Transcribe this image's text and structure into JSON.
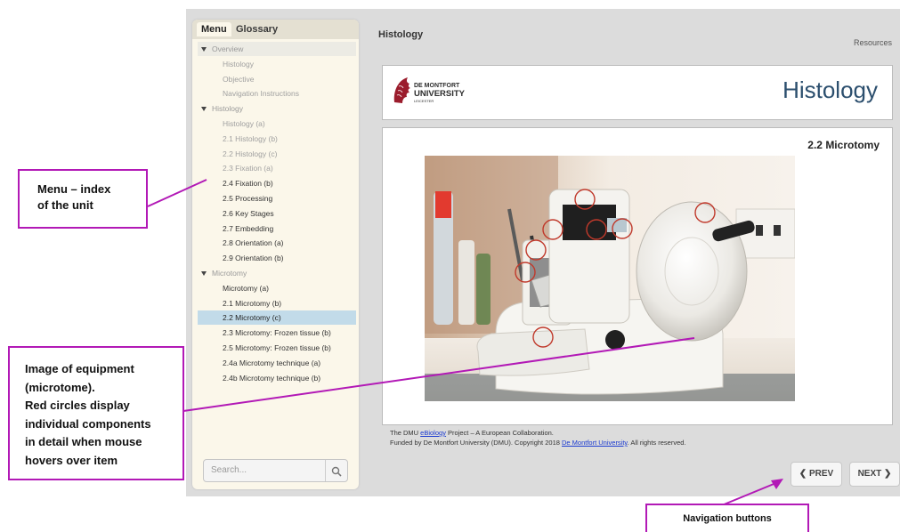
{
  "sidebar": {
    "tabs": [
      "Menu",
      "Glossary"
    ],
    "menu": [
      {
        "label": "Overview",
        "type": "section"
      },
      {
        "label": "Histology",
        "type": "dim"
      },
      {
        "label": "Objective",
        "type": "dim"
      },
      {
        "label": "Navigation Instructions",
        "type": "dim"
      },
      {
        "label": "Histology",
        "type": "section"
      },
      {
        "label": "Histology (a)",
        "type": "dim"
      },
      {
        "label": "2.1 Histology (b)",
        "type": "dim"
      },
      {
        "label": "2.2 Histology (c)",
        "type": "dim"
      },
      {
        "label": "2.3 Fixation (a)",
        "type": "dim"
      },
      {
        "label": "2.4 Fixation (b)",
        "type": "item"
      },
      {
        "label": "2.5 Processing",
        "type": "item"
      },
      {
        "label": "2.6 Key Stages",
        "type": "item"
      },
      {
        "label": "2.7 Embedding",
        "type": "item"
      },
      {
        "label": "2.8 Orientation (a)",
        "type": "item"
      },
      {
        "label": "2.9 Orientation (b)",
        "type": "item"
      },
      {
        "label": "Microtomy",
        "type": "section"
      },
      {
        "label": "Microtomy (a)",
        "type": "item"
      },
      {
        "label": "2.1 Microtomy (b)",
        "type": "item"
      },
      {
        "label": "2.2 Microtomy (c)",
        "type": "selected"
      },
      {
        "label": "2.3 Microtomy: Frozen tissue (b)",
        "type": "item"
      },
      {
        "label": "2.5 Microtomy: Frozen tissue (b)",
        "type": "item"
      },
      {
        "label": "2.4a Microtomy technique (a)",
        "type": "item"
      },
      {
        "label": "2.4b Microtomy technique (b)",
        "type": "item"
      }
    ],
    "search_placeholder": "Search..."
  },
  "header": {
    "title": "Histology",
    "resources": "Resources"
  },
  "banner": {
    "logo_line1": "DE MONTFORT",
    "logo_line2": "UNIVERSITY",
    "logo_line3": "LEICESTER",
    "title": "Histology"
  },
  "content": {
    "title": "2.2 Microtomy"
  },
  "footer": {
    "line1_pre": "The DMU ",
    "line1_link": "eBiology",
    "line1_post": " Project – A European Collaboration.",
    "line2_pre": "Funded by De Montfort University (DMU). Copyright 2018 ",
    "line2_link": "De Montfort University",
    "line2_post": ". All rights reserved."
  },
  "nav": {
    "prev": "PREV",
    "next": "NEXT"
  },
  "annotations": {
    "menu_line1": "Menu – index",
    "menu_line2": "of the unit",
    "image_line1": "Image of equipment",
    "image_line2": "(microtome).",
    "image_line3": "Red circles display",
    "image_line4": "individual components",
    "image_line5": "in detail when mouse",
    "image_line6": "hovers over item",
    "nav": "Navigation buttons"
  },
  "colors": {
    "annotation": "#b219b6",
    "selected": "#c2dbe9",
    "banner_title": "#2c4f6e",
    "link": "#1a3ad0"
  }
}
